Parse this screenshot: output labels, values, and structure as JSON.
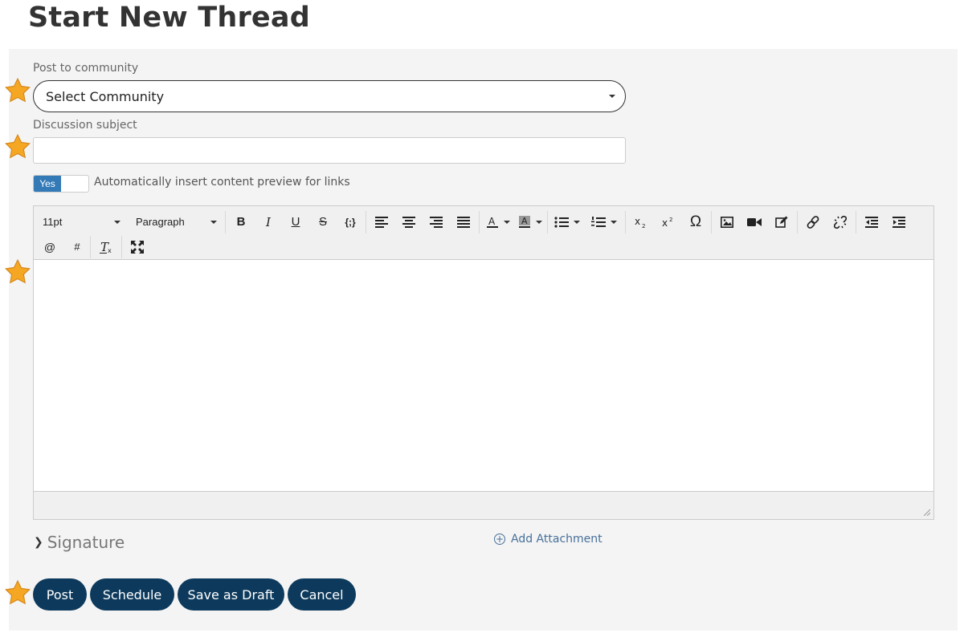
{
  "page": {
    "title": "Start New Thread"
  },
  "community": {
    "label": "Post to community",
    "selected": "Select Community"
  },
  "subject": {
    "label": "Discussion subject",
    "value": "",
    "placeholder": ""
  },
  "preview_toggle": {
    "state": "Yes",
    "label": "Automatically insert content preview for links"
  },
  "toolbar": {
    "font_size": "11pt",
    "block_format": "Paragraph",
    "bold": "B",
    "italic": "I",
    "underline": "U",
    "strike": "S",
    "code": "{;}",
    "omega": "Ω",
    "mention": "@",
    "hashtag": "#"
  },
  "signature": {
    "label": "Signature"
  },
  "attachment": {
    "label": "Add Attachment"
  },
  "actions": {
    "post": "Post",
    "schedule": "Schedule",
    "draft": "Save as Draft",
    "cancel": "Cancel"
  },
  "colors": {
    "primary": "#0d3a5c",
    "toggle_on": "#337ab7",
    "star": "#f5a623",
    "link": "#46709a"
  }
}
